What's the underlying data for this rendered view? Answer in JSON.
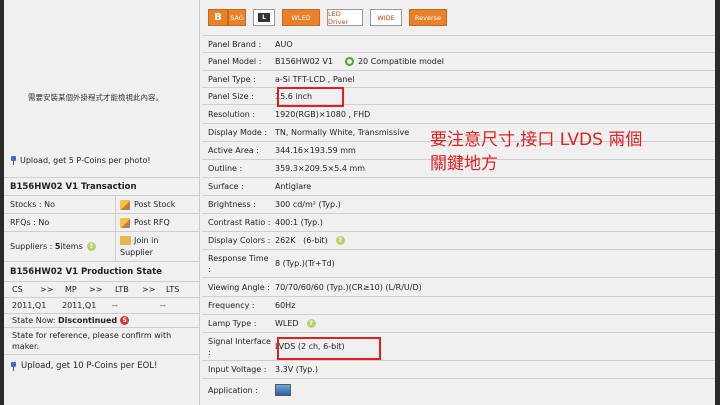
{
  "left": {
    "plugin_msg": "需要安裝某個外掛程式才能檢視此內容。",
    "upload_photo": "Upload, get 5 P-Coins per photo!",
    "transaction_title": "B156HW02 V1 Transaction",
    "stocks_label": "Stocks : No",
    "post_stock": "Post Stock",
    "rfqs_label": "RFQs : No",
    "post_rfq": "Post RFQ",
    "suppliers_prefix": "Suppliers : ",
    "suppliers_count": "5",
    "suppliers_suffix": " items",
    "join_supplier_1": "Join in",
    "join_supplier_2": "Supplier",
    "production_title": "B156HW02 V1 Production State",
    "stages": [
      "CS",
      ">>",
      "MP",
      ">>",
      "LTB",
      ">>",
      "LTS"
    ],
    "dates": [
      "2011,Q1",
      "2011,Q1",
      "--",
      "--"
    ],
    "state_label": "State Now: ",
    "state_value": "Discontinued",
    "state_badge": "S",
    "reference_1": "State for reference, please confirm with",
    "reference_2": "maker.",
    "upload_eol": "Upload, get 10 P-Coins per EOL!"
  },
  "iconbar": {
    "b": "B",
    "sag": "SAG",
    "l": "L",
    "wled": "WLED",
    "led_driver": "LED Driver",
    "wide": "WIDE",
    "reverse": "Reverse"
  },
  "specs": {
    "panel_brand": {
      "k": "Panel Brand :",
      "v": "AUO"
    },
    "panel_model": {
      "k": "Panel Model :",
      "v": "B156HW02 V1",
      "compat": "20 Compatible model"
    },
    "panel_type": {
      "k": "Panel Type :",
      "v": "a-Si TFT-LCD , Panel"
    },
    "panel_size": {
      "k": "Panel Size :",
      "v": "15.6 inch"
    },
    "resolution": {
      "k": "Resolution :",
      "v": "1920(RGB)×1080 , FHD"
    },
    "display_mode": {
      "k": "Display Mode :",
      "v": "TN, Normally White, Transmissive"
    },
    "active_area": {
      "k": "Active Area :",
      "v": "344.16×193.59 mm"
    },
    "outline": {
      "k": "Outline :",
      "v": "359.3×209.5×5.4 mm"
    },
    "surface": {
      "k": "Surface :",
      "v": "Antiglare"
    },
    "brightness": {
      "k": "Brightness :",
      "v": "300 cd/m² (Typ.)"
    },
    "contrast": {
      "k": "Contrast Ratio :",
      "v": "400:1 (Typ.)"
    },
    "colors": {
      "k": "Display Colors :",
      "v": "262K   (6-bit)"
    },
    "response_1": "Response Time",
    "response_2": ":",
    "response_v": "8 (Typ.)(Tr+Td)",
    "viewing": {
      "k": "Viewing Angle :",
      "v": "70/70/60/60 (Typ.)(CR≥10) (L/R/U/D)"
    },
    "frequency": {
      "k": "Frequency :",
      "v": "60Hz"
    },
    "lamp": {
      "k": "Lamp Type :",
      "v": "WLED"
    },
    "signal_1": "Signal Interface",
    "signal_2": ":",
    "signal_v": "LVDS (2 ch, 6-bit)",
    "voltage": {
      "k": "Input Voltage :",
      "v": "3.3V (Typ.)"
    },
    "application": {
      "k": "Application :"
    },
    "q": "?"
  },
  "annotation": {
    "line1": "要注意尺寸,接口 LVDS 兩個",
    "line2": "關鍵地方"
  },
  "colors": {
    "highlight": "#e02020",
    "accent": "#e8812a"
  }
}
